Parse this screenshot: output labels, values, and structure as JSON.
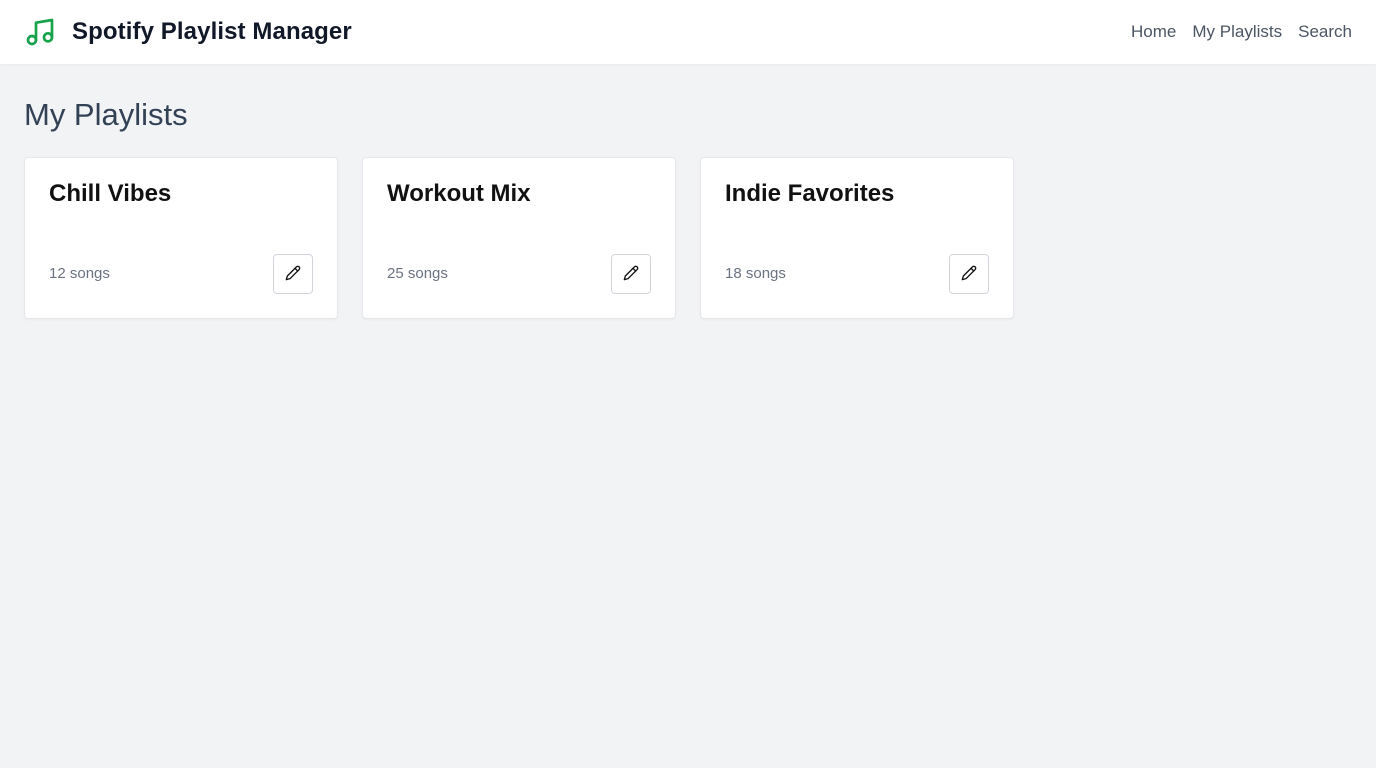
{
  "app": {
    "title": "Spotify Playlist Manager",
    "logo_icon": "music-note-icon",
    "accent_color": "#16a34a"
  },
  "nav": {
    "items": [
      {
        "label": "Home"
      },
      {
        "label": "My Playlists"
      },
      {
        "label": "Search"
      }
    ]
  },
  "page": {
    "title": "My Playlists"
  },
  "playlists": [
    {
      "name": "Chill Vibes",
      "count": "12 songs",
      "action_icon": "pencil-icon"
    },
    {
      "name": "Workout Mix",
      "count": "25 songs",
      "action_icon": "pencil-icon"
    },
    {
      "name": "Indie Favorites",
      "count": "18 songs",
      "action_icon": "pencil-icon"
    }
  ]
}
